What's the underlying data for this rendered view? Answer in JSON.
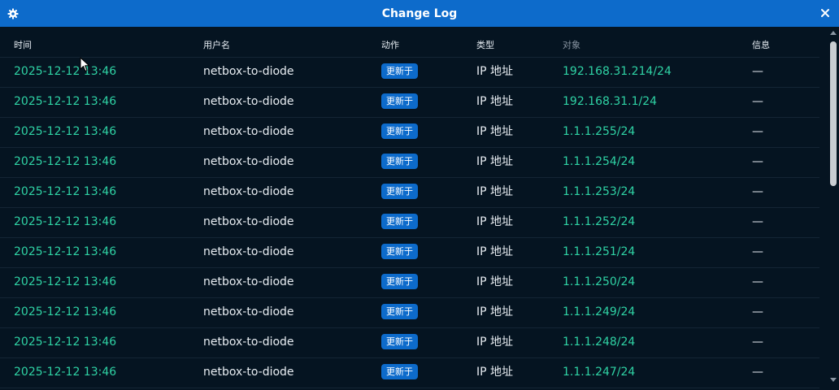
{
  "window": {
    "title": "Change Log"
  },
  "columns": {
    "time": "时间",
    "user": "用户名",
    "action": "动作",
    "type": "类型",
    "object": "对象",
    "message": "信息"
  },
  "rows": [
    {
      "time": "2025-12-12 13:46",
      "user": "netbox-to-diode",
      "action": "更新于",
      "type": "IP 地址",
      "object": "192.168.31.214/24",
      "message": "—"
    },
    {
      "time": "2025-12-12 13:46",
      "user": "netbox-to-diode",
      "action": "更新于",
      "type": "IP 地址",
      "object": "192.168.31.1/24",
      "message": "—"
    },
    {
      "time": "2025-12-12 13:46",
      "user": "netbox-to-diode",
      "action": "更新于",
      "type": "IP 地址",
      "object": "1.1.1.255/24",
      "message": "—"
    },
    {
      "time": "2025-12-12 13:46",
      "user": "netbox-to-diode",
      "action": "更新于",
      "type": "IP 地址",
      "object": "1.1.1.254/24",
      "message": "—"
    },
    {
      "time": "2025-12-12 13:46",
      "user": "netbox-to-diode",
      "action": "更新于",
      "type": "IP 地址",
      "object": "1.1.1.253/24",
      "message": "—"
    },
    {
      "time": "2025-12-12 13:46",
      "user": "netbox-to-diode",
      "action": "更新于",
      "type": "IP 地址",
      "object": "1.1.1.252/24",
      "message": "—"
    },
    {
      "time": "2025-12-12 13:46",
      "user": "netbox-to-diode",
      "action": "更新于",
      "type": "IP 地址",
      "object": "1.1.1.251/24",
      "message": "—"
    },
    {
      "time": "2025-12-12 13:46",
      "user": "netbox-to-diode",
      "action": "更新于",
      "type": "IP 地址",
      "object": "1.1.1.250/24",
      "message": "—"
    },
    {
      "time": "2025-12-12 13:46",
      "user": "netbox-to-diode",
      "action": "更新于",
      "type": "IP 地址",
      "object": "1.1.1.249/24",
      "message": "—"
    },
    {
      "time": "2025-12-12 13:46",
      "user": "netbox-to-diode",
      "action": "更新于",
      "type": "IP 地址",
      "object": "1.1.1.248/24",
      "message": "—"
    },
    {
      "time": "2025-12-12 13:46",
      "user": "netbox-to-diode",
      "action": "更新于",
      "type": "IP 地址",
      "object": "1.1.1.247/24",
      "message": "—"
    }
  ],
  "icons": {
    "settings": "gear-icon",
    "close": "close-icon"
  },
  "colors": {
    "titlebar": "#0d6bcb",
    "background": "#051421",
    "link": "#2fd3a5",
    "badge": "#0d6bcb"
  }
}
